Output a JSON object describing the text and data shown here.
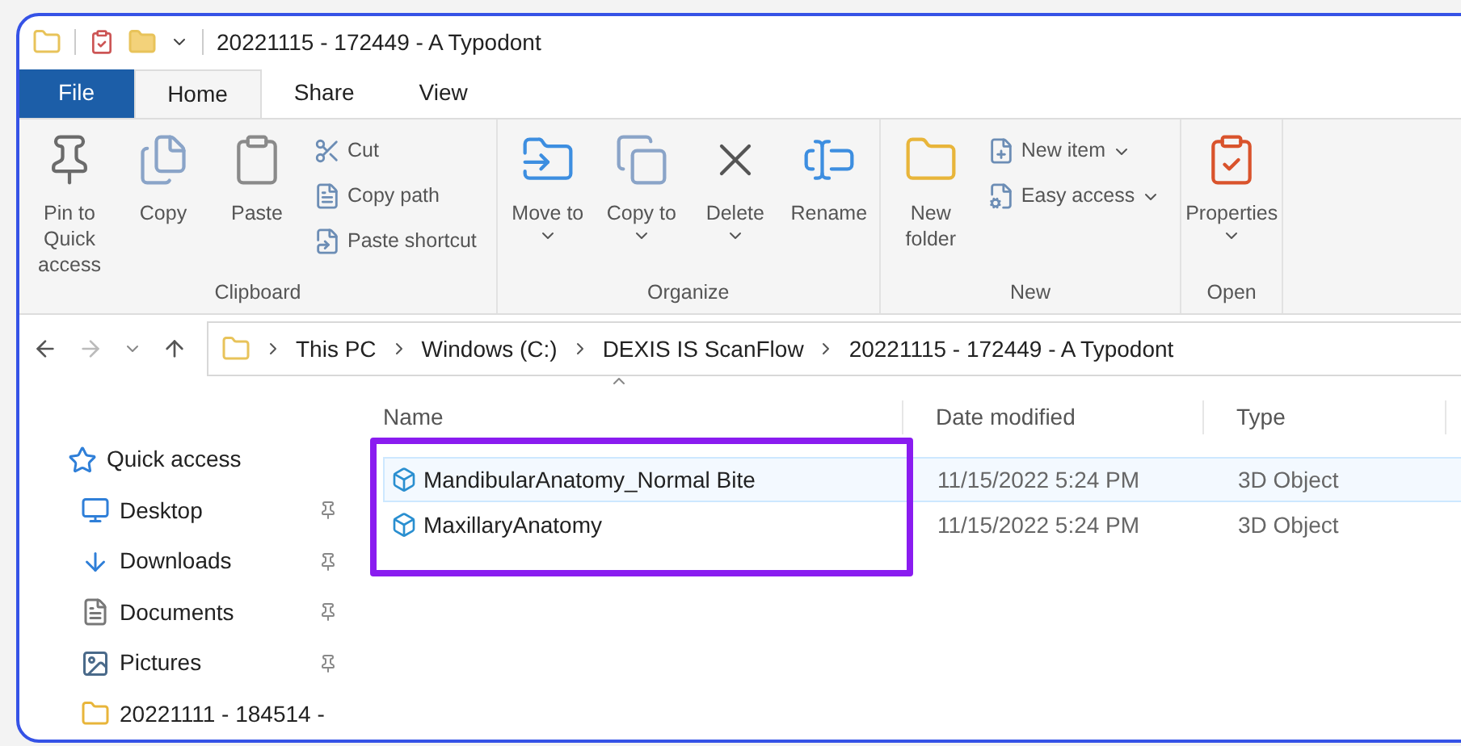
{
  "title_bar": {
    "title": "20221115 - 172449 - A Typodont"
  },
  "tabs": [
    {
      "label": "File",
      "kind": "file",
      "selected": false
    },
    {
      "label": "Home",
      "kind": "tab",
      "selected": true
    },
    {
      "label": "Share",
      "kind": "tab",
      "selected": false
    },
    {
      "label": "View",
      "kind": "tab",
      "selected": false
    }
  ],
  "ribbon": [
    {
      "label": "Clipboard",
      "large": [
        {
          "label": "Pin to Quick access",
          "dropdown": false
        },
        {
          "label": "Copy",
          "dropdown": false
        },
        {
          "label": "Paste",
          "dropdown": false
        }
      ],
      "small": [
        {
          "label": "Cut",
          "dropdown": false
        },
        {
          "label": "Copy path",
          "dropdown": false
        },
        {
          "label": "Paste shortcut",
          "dropdown": false
        }
      ]
    },
    {
      "label": "Organize",
      "large": [
        {
          "label": "Move to",
          "dropdown": true
        },
        {
          "label": "Copy to",
          "dropdown": true
        },
        {
          "label": "Delete",
          "dropdown": true
        },
        {
          "label": "Rename",
          "dropdown": false
        }
      ]
    },
    {
      "label": "New",
      "large": [
        {
          "label": "New folder",
          "dropdown": false
        }
      ],
      "small": [
        {
          "label": "New item",
          "dropdown": true
        },
        {
          "label": "Easy access",
          "dropdown": true
        }
      ]
    },
    {
      "label": "Open",
      "large": [
        {
          "label": "Properties",
          "dropdown": true
        }
      ]
    }
  ],
  "address_bar": {
    "breadcrumbs": [
      "This PC",
      "Windows (C:)",
      "DEXIS IS ScanFlow",
      "20221115 - 172449 - A Typodont"
    ]
  },
  "sidebar": [
    {
      "label": "Quick access",
      "kind": "header",
      "pinned": false
    },
    {
      "label": "Desktop",
      "kind": "desktop",
      "pinned": true
    },
    {
      "label": "Downloads",
      "kind": "downloads",
      "pinned": true
    },
    {
      "label": "Documents",
      "kind": "documents",
      "pinned": true
    },
    {
      "label": "Pictures",
      "kind": "pictures",
      "pinned": true
    },
    {
      "label": "20221111 - 184514 -",
      "kind": "folder",
      "pinned": false
    }
  ],
  "file_list": {
    "columns": [
      "Name",
      "Date modified",
      "Type"
    ],
    "rows": [
      {
        "name": "MandibularAnatomy_Normal Bite",
        "date_modified": "11/15/2022 5:24 PM",
        "type": "3D Object",
        "selected": true
      },
      {
        "name": "MaxillaryAnatomy",
        "date_modified": "11/15/2022 5:24 PM",
        "type": "3D Object",
        "selected": false
      }
    ]
  }
}
